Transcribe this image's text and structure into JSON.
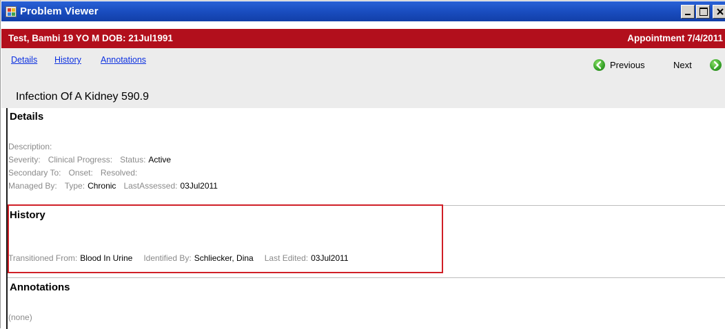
{
  "window": {
    "title": "Problem Viewer"
  },
  "patient_bar": {
    "patient": "Test, Bambi  19 YO  M DOB: 21Jul1991",
    "appointment": "Appointment  7/4/2011"
  },
  "nav": {
    "links": [
      "Details",
      "History",
      "Annotations"
    ],
    "previous_label": "Previous",
    "next_label": "Next"
  },
  "problem": {
    "name_code": "Infection Of A Kidney  590.9"
  },
  "details": {
    "heading": "Details",
    "description_label": "Description:",
    "severity_label": "Severity:",
    "clinical_progress_label": "Clinical Progress:",
    "status_label": "Status:",
    "status_value": "Active",
    "secondary_to_label": "Secondary To:",
    "onset_label": "Onset:",
    "resolved_label": "Resolved:",
    "managed_by_label": "Managed By:",
    "type_label": "Type:",
    "type_value": "Chronic",
    "last_assessed_label": "LastAssessed:",
    "last_assessed_value": "03Jul2011"
  },
  "history": {
    "heading": "History",
    "transitioned_from_label": "Transitioned From:",
    "transitioned_from_value": "Blood In Urine",
    "identified_by_label": "Identified By:",
    "identified_by_value": "Schliecker, Dina",
    "last_edited_label": "Last Edited:",
    "last_edited_value": "03Jul2011"
  },
  "annotations": {
    "heading": "Annotations",
    "empty_text": "(none)"
  },
  "colors": {
    "title_bar": "#1b4fc2",
    "patient_bar": "#b20f1c",
    "link": "#0a2fe0",
    "highlight_box": "#d01f26",
    "label_gray": "#8a8a8a"
  }
}
